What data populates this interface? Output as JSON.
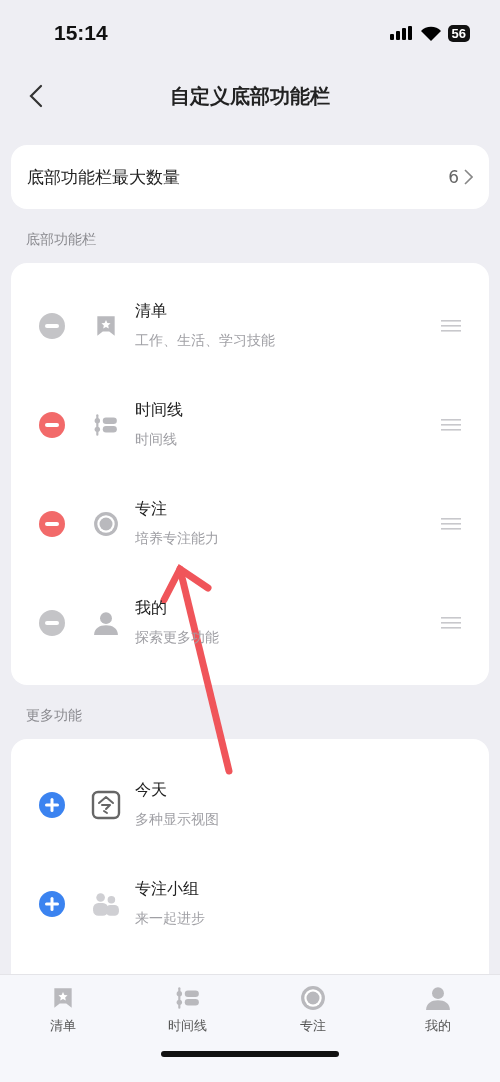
{
  "status_bar": {
    "time": "15:14",
    "battery": "56"
  },
  "header": {
    "title": "自定义底部功能栏"
  },
  "max_count": {
    "label": "底部功能栏最大数量",
    "value": "6"
  },
  "bottom_bar_section": {
    "title": "底部功能栏",
    "items": [
      {
        "kind": "list",
        "title": "清单",
        "subtitle": "工作、生活、学习技能",
        "disabled": true
      },
      {
        "kind": "timeline",
        "title": "时间线",
        "subtitle": "时间线",
        "disabled": false
      },
      {
        "kind": "focus",
        "title": "专注",
        "subtitle": "培养专注能力",
        "disabled": false
      },
      {
        "kind": "profile",
        "title": "我的",
        "subtitle": "探索更多功能",
        "disabled": true
      }
    ]
  },
  "more_section": {
    "title": "更多功能",
    "items": [
      {
        "kind": "today",
        "title": "今天",
        "subtitle": "多种显示视图"
      },
      {
        "kind": "group",
        "title": "专注小组",
        "subtitle": "来一起进步"
      }
    ]
  },
  "tab_bar": [
    {
      "kind": "list",
      "label": "清单"
    },
    {
      "kind": "timeline",
      "label": "时间线"
    },
    {
      "kind": "focus",
      "label": "专注"
    },
    {
      "kind": "profile",
      "label": "我的"
    }
  ]
}
